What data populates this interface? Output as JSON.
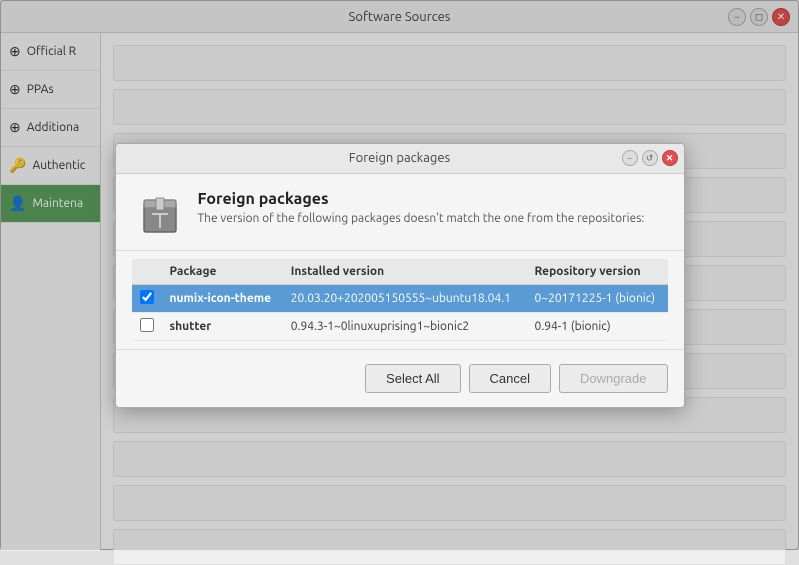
{
  "bg_window": {
    "title": "Software Sources",
    "controls": [
      "minimize",
      "restore",
      "close"
    ]
  },
  "sidebar": {
    "items": [
      {
        "id": "official",
        "label": "Official R",
        "icon": "⊕"
      },
      {
        "id": "ppas",
        "label": "PPAs",
        "icon": "⊕"
      },
      {
        "id": "additional",
        "label": "Additiona",
        "icon": "⊕"
      },
      {
        "id": "auth",
        "label": "Authentic",
        "icon": "🔑"
      },
      {
        "id": "maintenance",
        "label": "Maintena",
        "icon": "👤",
        "active": true
      }
    ]
  },
  "modal": {
    "title": "Foreign packages",
    "header_title": "Foreign packages",
    "header_description": "The version of the following packages doesn't match the one from the repositories:",
    "table": {
      "columns": [
        "Package",
        "Installed version",
        "Repository version"
      ],
      "rows": [
        {
          "selected": true,
          "package": "numix-icon-theme",
          "installed_version": "20.03.20+202005150555~ubuntu18.04.1",
          "repo_version": "0~20171225-1 (bionic)"
        },
        {
          "selected": false,
          "package": "shutter",
          "installed_version": "0.94.3-1~0linuxuprising1~bionic2",
          "repo_version": "0.94-1 (bionic)"
        }
      ]
    },
    "buttons": {
      "select_all": "Select All",
      "cancel": "Cancel",
      "downgrade": "Downgrade"
    }
  }
}
